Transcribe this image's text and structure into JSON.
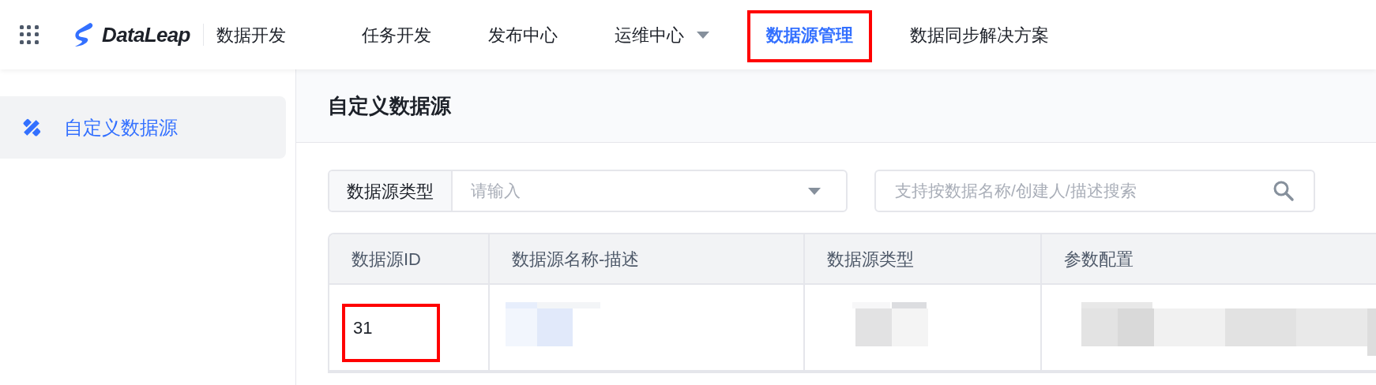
{
  "header": {
    "brand": "DataLeap",
    "product": "数据开发",
    "nav": [
      {
        "label": "任务开发",
        "selected": false,
        "dropdown": false,
        "highlighted": false
      },
      {
        "label": "发布中心",
        "selected": false,
        "dropdown": false,
        "highlighted": false
      },
      {
        "label": "运维中心",
        "selected": false,
        "dropdown": true,
        "highlighted": false
      },
      {
        "label": "数据源管理",
        "selected": true,
        "dropdown": false,
        "highlighted": true
      },
      {
        "label": "数据同步解决方案",
        "selected": false,
        "dropdown": false,
        "highlighted": false
      }
    ]
  },
  "sidebar": {
    "items": [
      {
        "label": "自定义数据源",
        "selected": true
      }
    ]
  },
  "page_title": "自定义数据源",
  "filters": {
    "type_label": "数据源类型",
    "type_placeholder": "请输入",
    "search_placeholder": "支持按数据名称/创建人/描述搜索"
  },
  "table": {
    "columns": [
      "数据源ID",
      "数据源名称-描述",
      "数据源类型",
      "参数配置"
    ],
    "rows": [
      {
        "id": "31",
        "highlighted": true
      }
    ]
  }
}
